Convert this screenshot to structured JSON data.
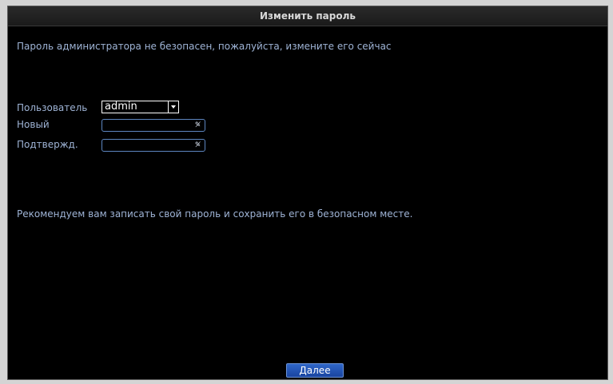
{
  "dialog": {
    "title": "Изменить пароль",
    "warning": "Пароль администратора не безопасен, пожалуйста, измените его сейчас",
    "recommendation": "Рекомендуем вам записать свой пароль и сохранить его в безопасном месте."
  },
  "form": {
    "user_label": "Пользователь",
    "user_value": "admin",
    "new_label": "Новый",
    "new_value": "",
    "confirm_label": "Подтвержд.",
    "confirm_value": ""
  },
  "actions": {
    "next_label": "Далее"
  },
  "icons": {
    "password_toggle": "eye-slash-icon",
    "dropdown": "chevron-down-icon"
  }
}
